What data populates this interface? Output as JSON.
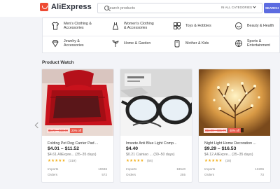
{
  "header": {
    "brand": "AliExpress",
    "search_placeholder": "Search products",
    "category_select": "IN ALL CATEGORIES",
    "search_button": "SEARCH"
  },
  "categories": [
    {
      "line1": "Men's Clothing &",
      "line2": "Accessories",
      "icon": "shirt-icon"
    },
    {
      "line1": "Women's Clothing",
      "line2": "& Accessories",
      "icon": "dress-icon"
    },
    {
      "line1": "Toys & Hobbies",
      "line2": "",
      "icon": "toy-icon"
    },
    {
      "line1": "Beauty & Health",
      "line2": "",
      "icon": "beauty-icon"
    },
    {
      "line1": "Jewelry &",
      "line2": "Accessories",
      "icon": "jewelry-icon"
    },
    {
      "line1": "Home & Garden",
      "line2": "",
      "icon": "plant-icon"
    },
    {
      "line1": "Mother & Kids",
      "line2": "",
      "icon": "baby-icon"
    },
    {
      "line1": "Sports &",
      "line2": "Entertainment",
      "icon": "sports-icon"
    }
  ],
  "section_title": "Product Watch",
  "products": [
    {
      "old_price": "$5.79 – $18.49",
      "discount": "20% off",
      "title": "Folding Pet Dog Carrier Pad ...",
      "price": "$4.01 – $11.52",
      "sub": "$4.61 AliExpre... (35–35 days)",
      "stars": "★★★★★",
      "reviews": "(319)",
      "imports_label": "Imports",
      "imports_value": "10636",
      "orders_label": "Orders",
      "orders_value": "572"
    },
    {
      "old_price": "",
      "discount": "",
      "title": "Imwete Anti Blue Light Comp...",
      "price": "$4.40",
      "sub": "$0.21 Cainiao ... (30–50 days)",
      "stars": "★★★★★",
      "reviews": "(56)",
      "imports_label": "Imports",
      "imports_value": "18540",
      "orders_label": "Orders",
      "orders_value": "255"
    },
    {
      "old_price": "$11.99 – $31.79",
      "discount": "48% off",
      "title": "Night Light Home Decoration ...",
      "price": "$9.29 – $16.53",
      "sub": "$4.12 AliExpre... (35–35 days)",
      "stars": "★★★★★",
      "reviews": "(28)",
      "imports_label": "Imports",
      "imports_value": "13206",
      "orders_label": "Orders",
      "orders_value": "73"
    }
  ]
}
